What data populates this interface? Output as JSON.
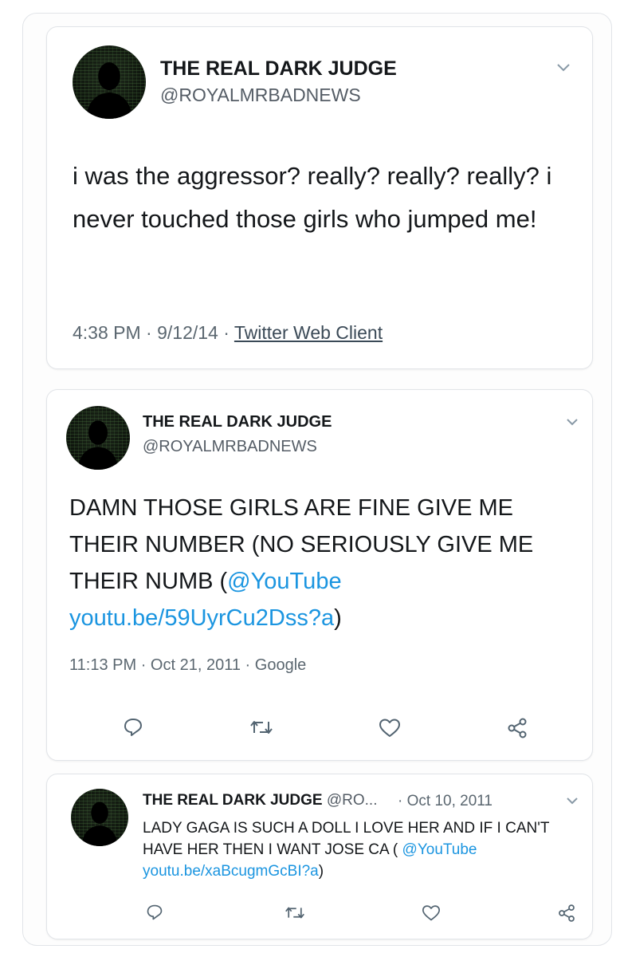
{
  "tweet1": {
    "name": "THE REAL DARK JUDGE",
    "handle": "@ROYALMRBADNEWS",
    "text": "i was the aggressor? really? really? really? i never touched those girls who jumped me!",
    "time": "4:38 PM",
    "date": "9/12/14",
    "sep": "·",
    "client": "Twitter Web Client"
  },
  "tweet2": {
    "name": "THE REAL DARK JUDGE",
    "handle": "@ROYALMRBADNEWS",
    "text_plain": "DAMN THOSE GIRLS ARE FINE GIVE ME THEIR NUMBER (NO SERIOUSLY GIVE ME THEIR NUMB (",
    "mention": "@YouTube",
    "url": "youtu.be/59UyrCu2Dss?a",
    "close_paren": ")",
    "time": "11:13 PM",
    "date": "Oct 21, 2011",
    "sep": "·",
    "client": "Google"
  },
  "tweet3": {
    "name": "THE REAL DARK JUDGE",
    "handle_trunc": "@RO...",
    "date": "· Oct 10, 2011",
    "text_plain": "LADY GAGA IS SUCH A DOLL I LOVE HER AND IF I CAN'T HAVE HER THEN I WANT JOSE CA (",
    "mention": "@YouTube",
    "url": "youtu.be/xaBcugmGcBI?a",
    "close_paren": ")"
  },
  "icons": [
    "reply-icon",
    "retweet-icon",
    "like-icon",
    "share-icon",
    "chevron-down-icon"
  ],
  "colors": {
    "link": "#1b95e0",
    "text": "#14171a",
    "meta": "#5b6770",
    "border": "#e1e4e8"
  }
}
